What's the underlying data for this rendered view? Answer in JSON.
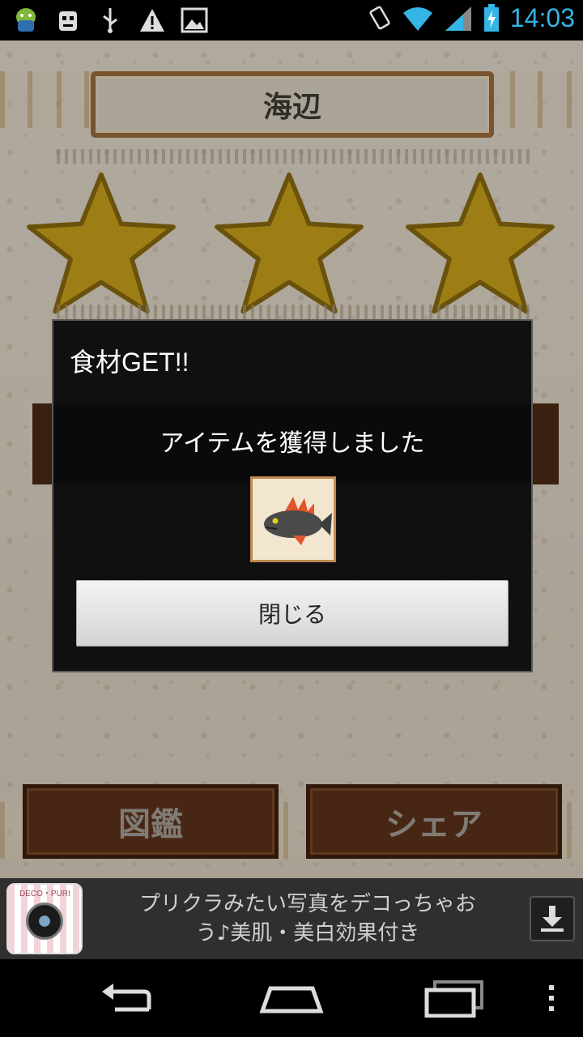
{
  "status_bar": {
    "time": "14:03",
    "icons": [
      "android-icon",
      "robot-icon",
      "usb-icon",
      "warning-icon",
      "image-icon",
      "vibrate-icon",
      "wifi-icon",
      "signal-icon",
      "battery-charging-icon"
    ]
  },
  "screen": {
    "title": "海辺",
    "stars": 3,
    "buttons": {
      "encyclopedia": "図鑑",
      "share": "シェア"
    }
  },
  "dialog": {
    "title": "食材GET!!",
    "message": "アイテムを獲得しました",
    "item_icon": "fish-item-icon",
    "close_label": "閉じる"
  },
  "ad": {
    "brand": "DECO・PURI",
    "line1": "プリクラみたい写真をデコっちゃお",
    "line2": "う♪美肌・美白効果付き",
    "download_icon": "download-icon"
  },
  "nav": {
    "icons": [
      "back-icon",
      "home-icon",
      "recent-apps-icon",
      "overflow-menu-icon"
    ]
  },
  "colors": {
    "clock": "#33b5e5",
    "dialog_bg": "#101010",
    "star_gold": "#c9a21a"
  }
}
